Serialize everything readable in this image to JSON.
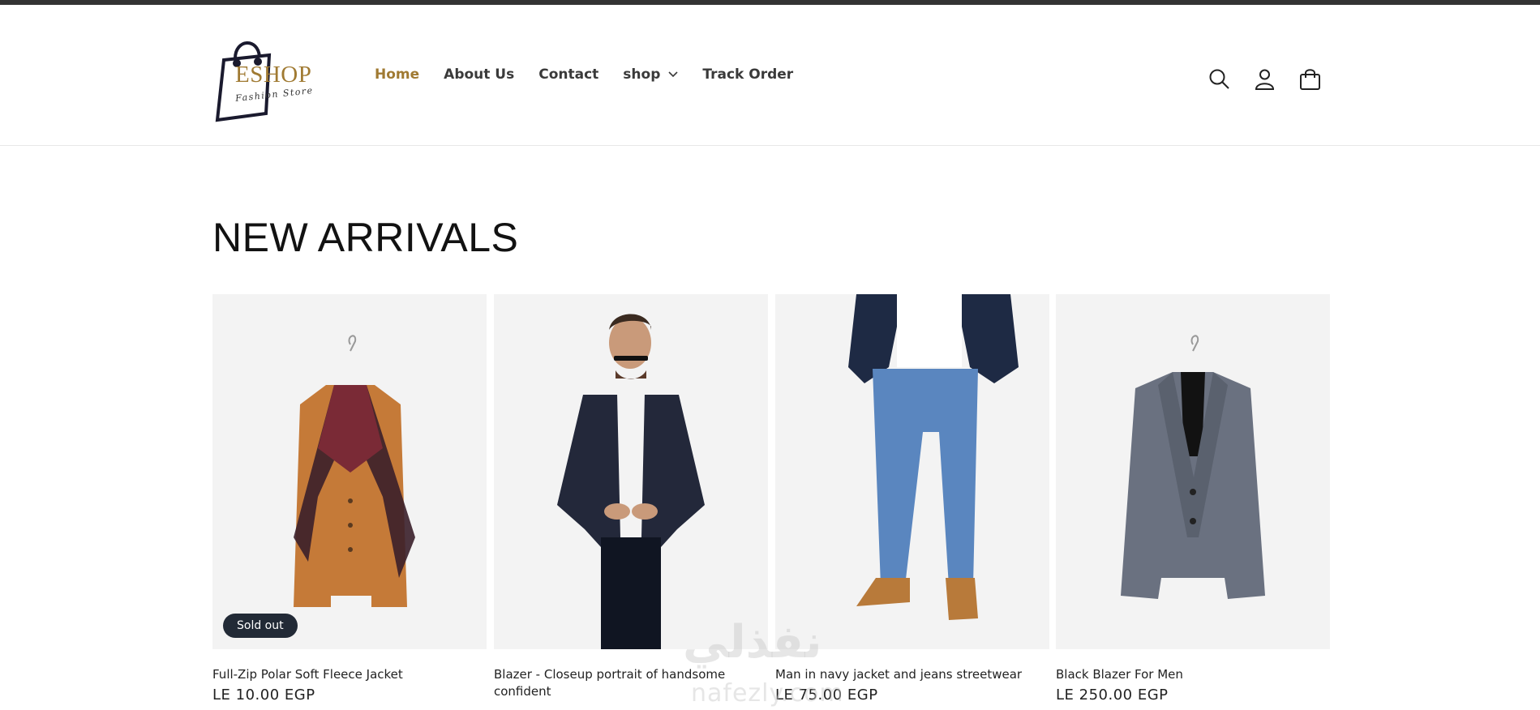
{
  "header": {
    "logo": {
      "word": "ESHOP",
      "sub": "Fashion Store"
    },
    "nav": [
      {
        "label": "Home",
        "active": true
      },
      {
        "label": "About Us",
        "active": false
      },
      {
        "label": "Contact",
        "active": false
      },
      {
        "label": "shop",
        "active": false,
        "has_dropdown": true
      },
      {
        "label": "Track Order",
        "active": false
      }
    ],
    "icons": [
      "search-icon",
      "account-icon",
      "cart-icon"
    ]
  },
  "section": {
    "title": "NEW ARRIVALS"
  },
  "products": [
    {
      "title": "Full-Zip Polar Soft Fleece Jacket",
      "price": "LE 10.00 EGP",
      "badge": "Sold out"
    },
    {
      "title": "Blazer - Closeup portrait of handsome confident",
      "price": "",
      "badge": ""
    },
    {
      "title": "Man in navy jacket and jeans streetwear",
      "price": "LE 75.00 EGP",
      "badge": ""
    },
    {
      "title": "Black Blazer For Men",
      "price": "LE 250.00 EGP",
      "badge": ""
    }
  ],
  "watermark": {
    "arabic": "نفذلي",
    "latin": "nafezly.com"
  },
  "colors": {
    "accent": "#a07a32",
    "text": "#121212",
    "badge_bg": "#222a36",
    "topbar": "#333333"
  }
}
